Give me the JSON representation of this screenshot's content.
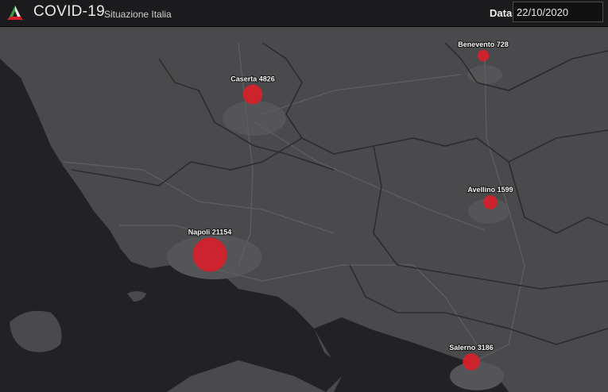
{
  "header": {
    "title": "COVID-19",
    "subtitle": "Situazione Italia",
    "date_label": "Data",
    "date_value": "22/10/2020"
  },
  "map": {
    "marker_color": "#d8202a",
    "markers": [
      {
        "province": "Benevento",
        "cases": 728,
        "label": "Benevento 728"
      },
      {
        "province": "Caserta",
        "cases": 4826,
        "label": "Caserta 4826"
      },
      {
        "province": "Avellino",
        "cases": 1599,
        "label": "Avellino 1599"
      },
      {
        "province": "Napoli",
        "cases": 21154,
        "label": "Napoli 21154"
      },
      {
        "province": "Salerno",
        "cases": 3186,
        "label": "Salerno 3186"
      }
    ]
  }
}
